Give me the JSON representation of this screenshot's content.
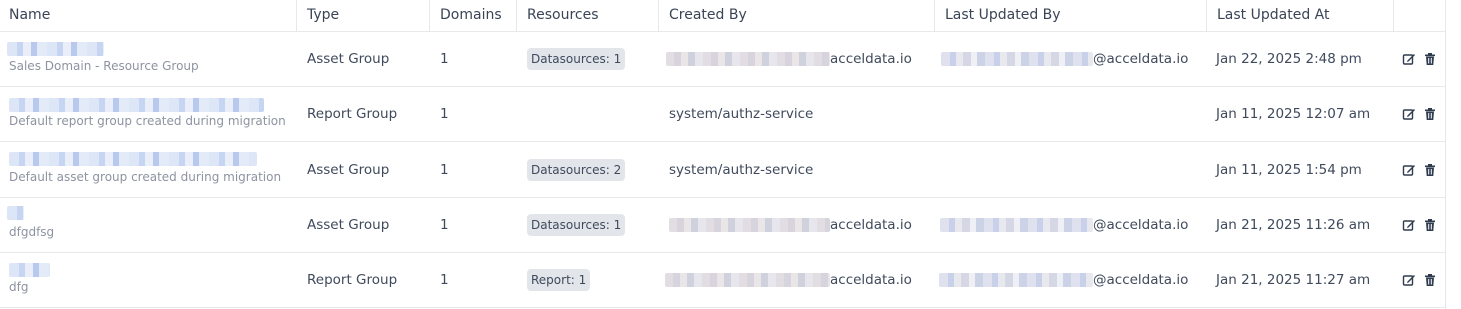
{
  "columns": {
    "name": "Name",
    "type": "Type",
    "domains": "Domains",
    "resources": "Resources",
    "created_by": "Created By",
    "last_updated_by": "Last Updated By",
    "last_updated_at": "Last Updated At"
  },
  "rows": [
    {
      "subname": "Sales Domain - Resource Group",
      "type": "Asset Group",
      "domains": "1",
      "resource_badge": "Datasources: 1",
      "created_by": "acceldata.io",
      "updated_by": "@acceldata.io",
      "updated_at": "Jan 22, 2025 2:48 pm"
    },
    {
      "subname": "Default report group created during migration",
      "type": "Report Group",
      "domains": "1",
      "resource_badge": "",
      "created_by": "system/authz-service",
      "updated_by": "",
      "updated_at": "Jan 11, 2025 12:07 am"
    },
    {
      "subname": "Default asset group created during migration",
      "type": "Asset Group",
      "domains": "1",
      "resource_badge": "Datasources: 2",
      "created_by": "system/authz-service",
      "updated_by": "",
      "updated_at": "Jan 11, 2025 1:54 pm"
    },
    {
      "subname": "dfgdfsg",
      "type": "Asset Group",
      "domains": "1",
      "resource_badge": "Datasources: 1",
      "created_by": "acceldata.io",
      "updated_by": "@acceldata.io",
      "updated_at": "Jan 21, 2025 11:26 am"
    },
    {
      "subname": "dfg",
      "type": "Report Group",
      "domains": "1",
      "resource_badge": "Report: 1",
      "created_by": "acceldata.io",
      "updated_by": "@acceldata.io",
      "updated_at": "Jan 21, 2025 11:27 am"
    }
  ],
  "actions": {
    "edit_icon": "edit-icon",
    "delete_icon": "trash-icon"
  }
}
